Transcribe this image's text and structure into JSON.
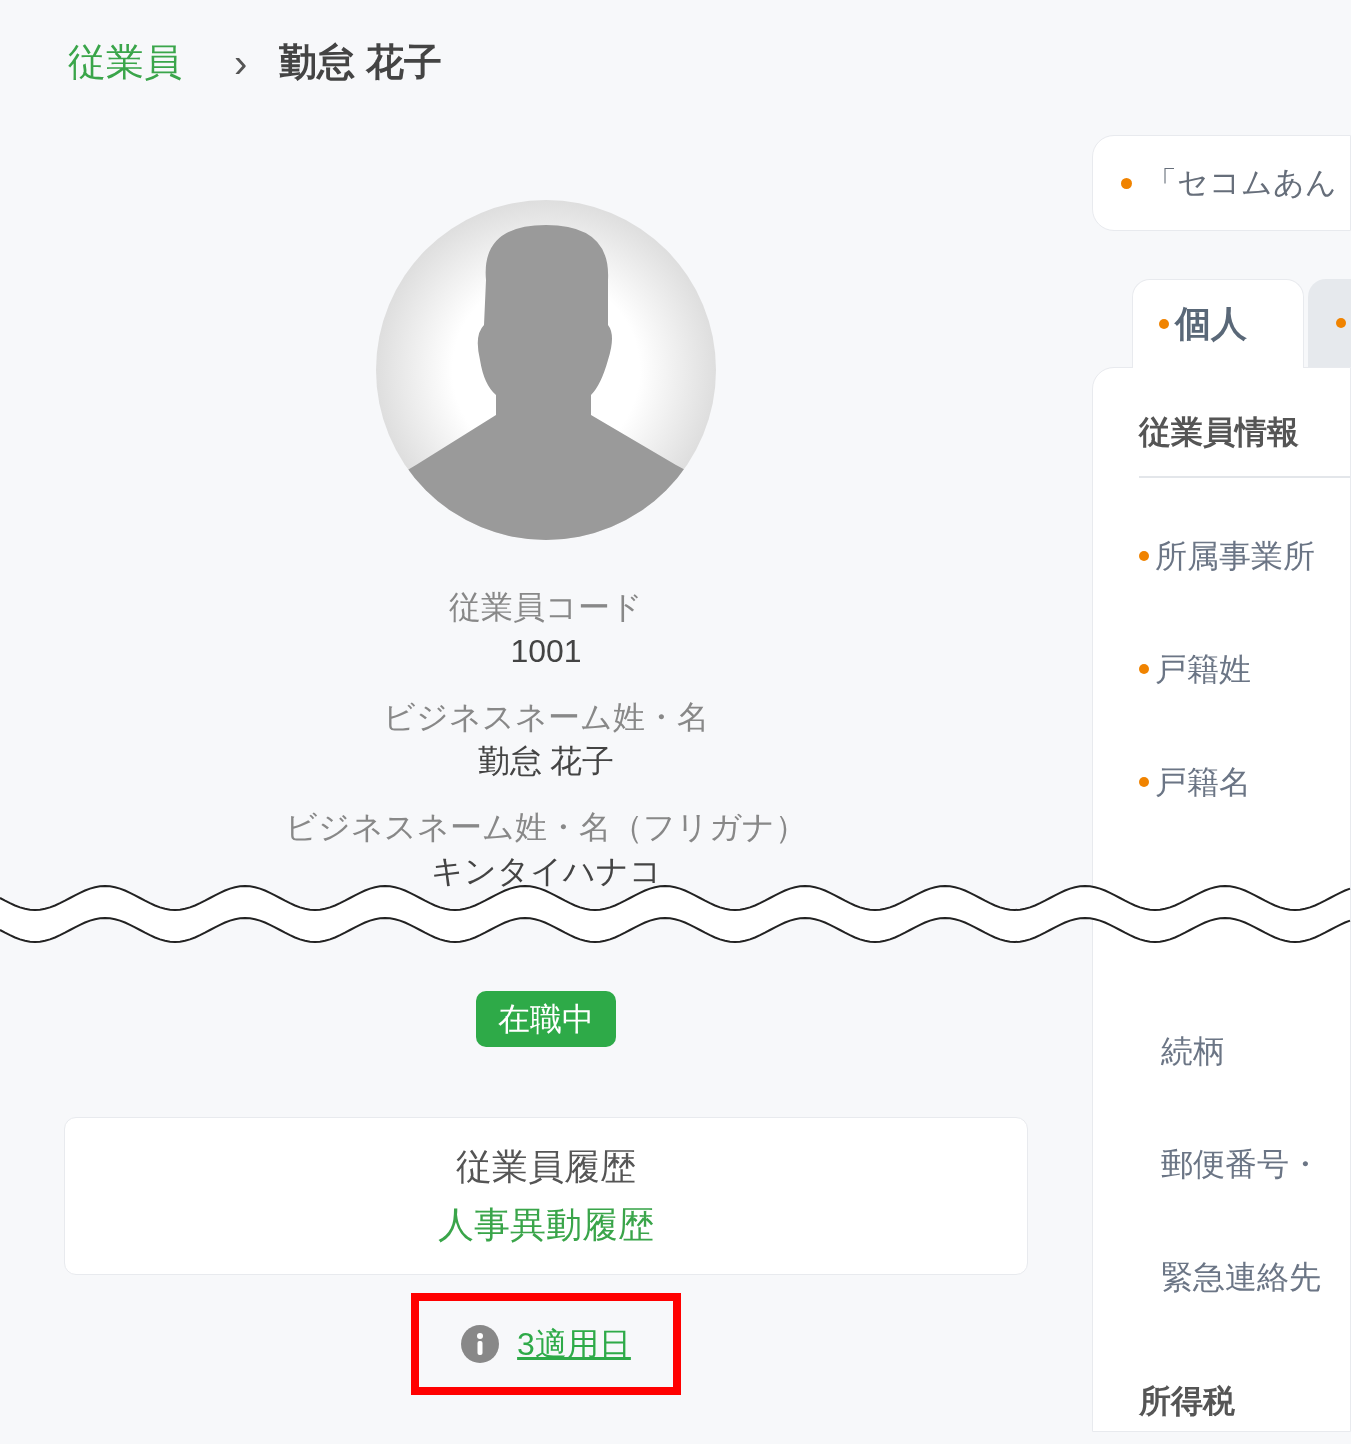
{
  "breadcrumb": {
    "parent": "従業員",
    "separator": "›",
    "current": "勤怠 花子"
  },
  "profile": {
    "fields": [
      {
        "label": "従業員コード",
        "value": "1001"
      },
      {
        "label": "ビジネスネーム姓・名",
        "value": "勤怠 花子"
      },
      {
        "label": "ビジネスネーム姓・名（フリガナ）",
        "value": "キンタイハナコ"
      }
    ],
    "status": "在職中",
    "history": {
      "title": "従業員履歴",
      "link": "人事異動履歴"
    },
    "applied_dates": "3適用日"
  },
  "notice": {
    "text": "「セコムあん"
  },
  "tabs": [
    {
      "label": "個人",
      "selected": true
    },
    {
      "selected": false
    }
  ],
  "sections": [
    {
      "title": "従業員情報",
      "items": [
        {
          "label": "所属事業所",
          "required": true
        },
        {
          "label": "戸籍姓",
          "required": true
        },
        {
          "label": "戸籍名",
          "required": true
        },
        {
          "label": "続柄",
          "required": false
        },
        {
          "label": "郵便番号・",
          "required": false
        },
        {
          "label": "緊急連絡先",
          "required": false
        }
      ]
    },
    {
      "title": "所得税"
    }
  ]
}
